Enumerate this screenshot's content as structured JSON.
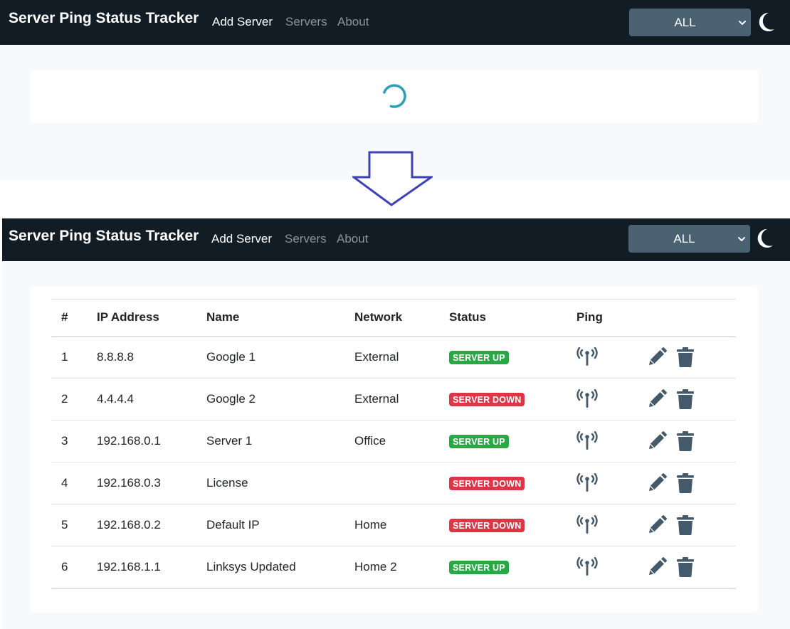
{
  "navbar": {
    "brand": "Server Ping Status Tracker",
    "links": [
      "Add Server",
      "Servers",
      "About"
    ],
    "filter_value": "ALL",
    "theme_icon": "moon-icon"
  },
  "table": {
    "headers": [
      "#",
      "IP Address",
      "Name",
      "Network",
      "Status",
      "Ping"
    ],
    "rows": [
      {
        "num": "1",
        "ip": "8.8.8.8",
        "name": "Google 1",
        "network": "External",
        "status": "SERVER UP"
      },
      {
        "num": "2",
        "ip": "4.4.4.4",
        "name": "Google 2",
        "network": "External",
        "status": "SERVER DOWN"
      },
      {
        "num": "3",
        "ip": "192.168.0.1",
        "name": "Server 1",
        "network": "Office",
        "status": "SERVER UP"
      },
      {
        "num": "4",
        "ip": "192.168.0.3",
        "name": "License",
        "network": "",
        "status": "SERVER DOWN"
      },
      {
        "num": "5",
        "ip": "192.168.0.2",
        "name": "Default IP",
        "network": "Home",
        "status": "SERVER DOWN"
      },
      {
        "num": "6",
        "ip": "192.168.1.1",
        "name": "Linksys Updated",
        "network": "Home 2",
        "status": "SERVER UP"
      }
    ]
  },
  "colors": {
    "navbar_bg": "#121c24",
    "select_bg": "#4a6272",
    "status_up": "#28a745",
    "status_down": "#dc3545",
    "icon": "#44596a",
    "arrow": "#3d42b8",
    "spinner": "#2aa0b8"
  },
  "icons": [
    "loading-spinner-icon",
    "arrow-down-icon",
    "chevron-down-icon",
    "moon-icon",
    "antenna-ping-icon",
    "pencil-edit-icon",
    "trash-delete-icon"
  ]
}
